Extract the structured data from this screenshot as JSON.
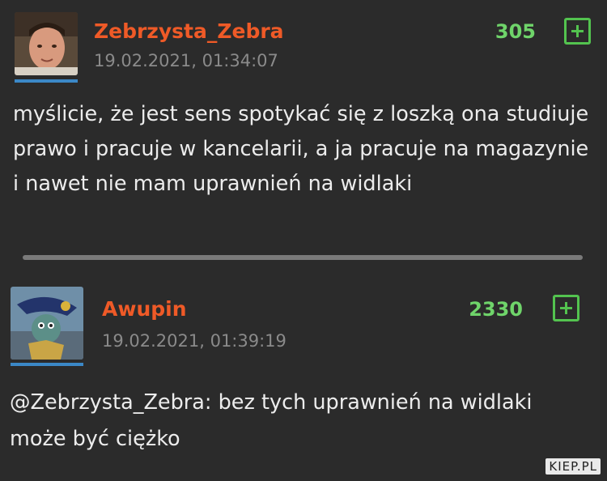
{
  "comments": [
    {
      "username": "Zebrzysta_Zebra",
      "timestamp": "19.02.2021, 01:34:07",
      "score": "305",
      "text": "myślicie, że jest sens spotykać się z loszką ona studiuje prawo i pracuje w kancelarii, a ja pracuje na magazynie i nawet nie mam uprawnień na widlaki"
    },
    {
      "username": "Awupin",
      "timestamp": "19.02.2021, 01:39:19",
      "score": "2330",
      "mention": "@Zebrzysta_Zebra",
      "text": ": bez tych uprawnień na widlaki może być ciężko"
    }
  ],
  "watermark": "KIEP.PL",
  "colors": {
    "background": "#2b2b2b",
    "username": "#ef5a27",
    "score": "#6fd46a",
    "timestamp": "#8a8a8a",
    "text": "#ececec",
    "avatar_bar": "#3b88c7"
  },
  "icons": [
    "user-avatar",
    "plus-icon"
  ]
}
